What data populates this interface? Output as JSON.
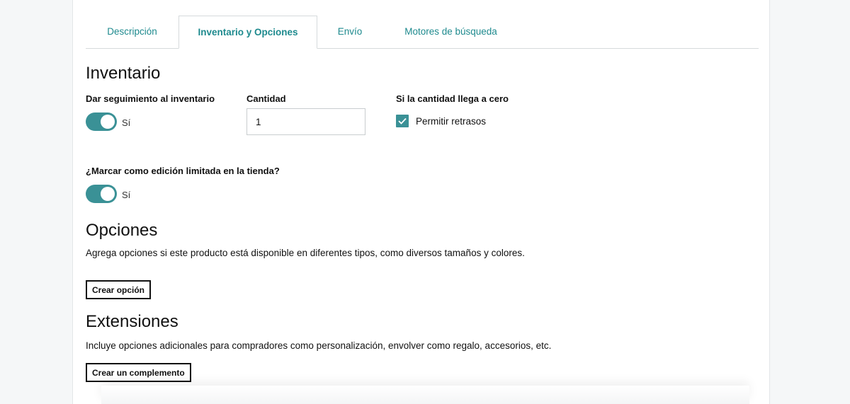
{
  "tabs": [
    {
      "label": "Descripción",
      "active": false
    },
    {
      "label": "Inventario y Opciones",
      "active": true
    },
    {
      "label": "Envío",
      "active": false
    },
    {
      "label": "Motores de búsqueda",
      "active": false
    }
  ],
  "inventory": {
    "heading": "Inventario",
    "track_label": "Dar seguimiento al inventario",
    "track_toggle_text": "Sí",
    "track_enabled": true,
    "quantity_label": "Cantidad",
    "quantity_value": "1",
    "zero_label": "Si la cantidad llega a cero",
    "allow_backorder_label": "Permitir retrasos",
    "allow_backorder_checked": true,
    "limited_label": "¿Marcar como edición limitada en la tienda?",
    "limited_toggle_text": "Sí",
    "limited_enabled": true
  },
  "options": {
    "heading": "Opciones",
    "description": "Agrega opciones si este producto está disponible en diferentes tipos, como diversos tamaños y colores.",
    "create_button": "Crear opción"
  },
  "extensions": {
    "heading": "Extensiones",
    "description": "Incluye opciones adicionales para compradores como personalización, envolver como regalo, accesorios, etc.",
    "create_button": "Crear un complemento"
  },
  "colors": {
    "accent": "#3a9196",
    "tab_text": "#1e8a8e"
  },
  "icons": {
    "checkbox_check": "check-icon"
  }
}
